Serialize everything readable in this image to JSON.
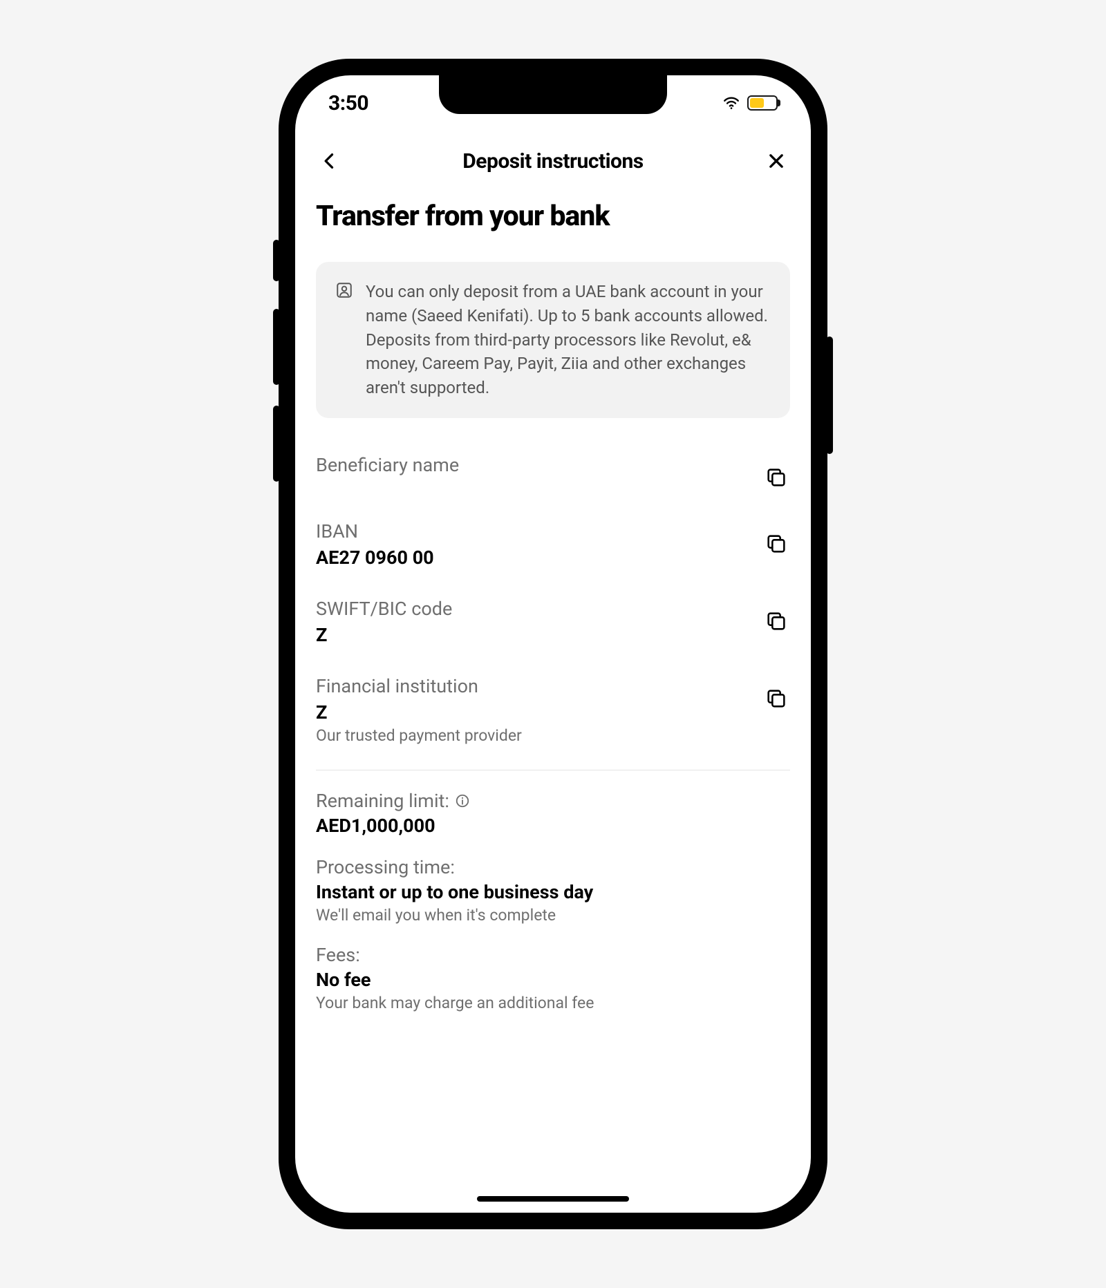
{
  "status": {
    "time": "3:50"
  },
  "header": {
    "title": "Deposit instructions"
  },
  "page": {
    "title": "Transfer from your bank"
  },
  "notice": {
    "text": "You can only deposit from a UAE bank account in your name (Saeed Kenifati). Up to 5 bank accounts allowed. Deposits from third-party processors like Revolut, e& money, Careem Pay, Payit, Ziia and other exchanges aren't supported."
  },
  "fields": {
    "beneficiary": {
      "label": "Beneficiary name",
      "value": ""
    },
    "iban": {
      "label": "IBAN",
      "value": "AE27 0960 00"
    },
    "swift": {
      "label": "SWIFT/BIC code",
      "value": "Z"
    },
    "institution": {
      "label": "Financial institution",
      "value": "Z",
      "sub": "Our trusted payment provider"
    }
  },
  "limits": {
    "remaining": {
      "label": "Remaining limit:",
      "value": "AED1,000,000"
    },
    "processing": {
      "label": "Processing time:",
      "value": "Instant or up to one business day",
      "sub": "We'll email you when it's complete"
    },
    "fees": {
      "label": "Fees:",
      "value": "No fee",
      "sub": "Your bank may charge an additional fee"
    }
  }
}
